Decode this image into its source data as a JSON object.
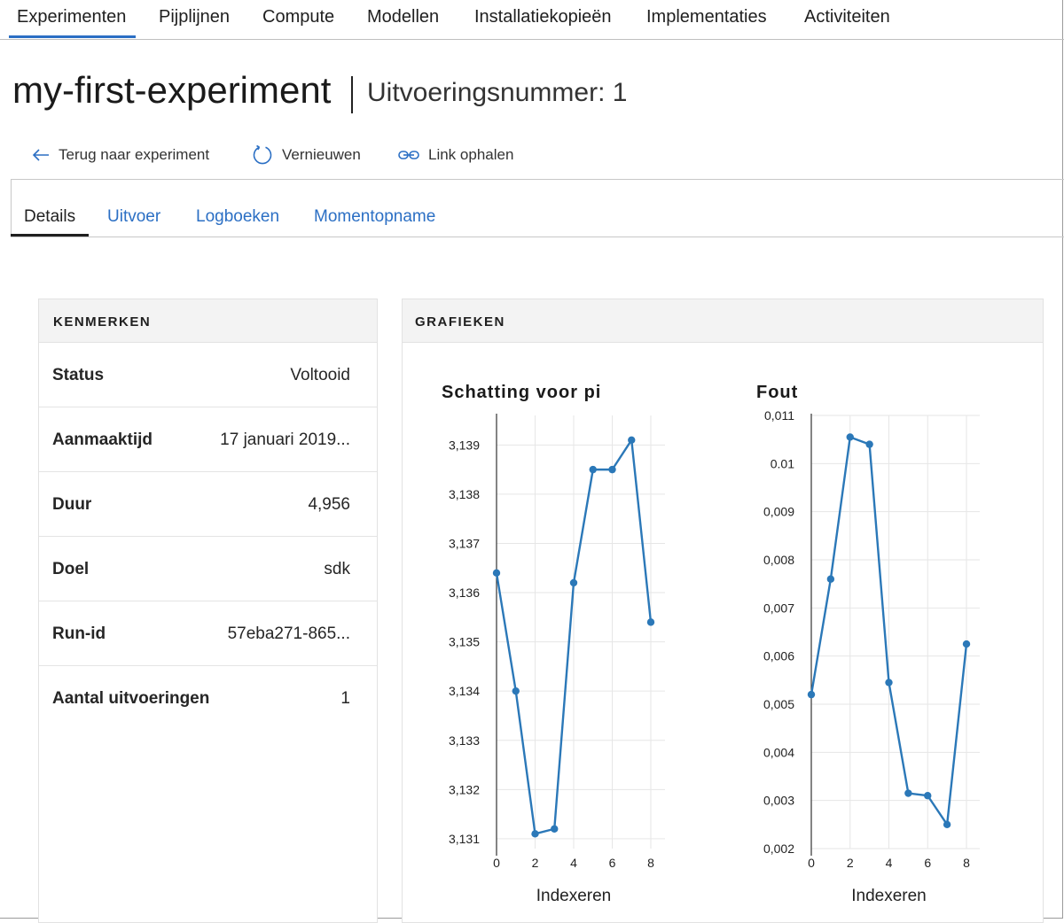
{
  "topnav": {
    "items": [
      "Experimenten",
      "Pijplijnen",
      "Compute",
      "Modellen",
      "Installatiekopieën",
      "Implementaties",
      "Activiteiten"
    ],
    "active": "Experimenten"
  },
  "header": {
    "title": "my-first-experiment",
    "subtitle": "Uitvoeringsnummer: 1"
  },
  "actions": {
    "back": "Terug naar experiment",
    "refresh": "Vernieuwen",
    "link": "Link ophalen"
  },
  "subtabs": {
    "items": [
      "Details",
      "Uitvoer",
      "Logboeken",
      "Momentopname"
    ],
    "active": "Details"
  },
  "properties": {
    "heading": "KENMERKEN",
    "rows": [
      {
        "key": "Status",
        "value": "Voltooid"
      },
      {
        "key": "Aanmaaktijd",
        "value": "17 januari 2019..."
      },
      {
        "key": "Duur",
        "value": "4,956"
      },
      {
        "key": "Doel",
        "value": "sdk"
      },
      {
        "key": "Run-id",
        "value": "57eba271-865..."
      },
      {
        "key": "Aantal uitvoeringen",
        "value": "1"
      }
    ]
  },
  "charts": {
    "heading": "GRAFIEKEN",
    "color": "#2b78b8"
  },
  "chart_data": [
    {
      "type": "line",
      "title": "Schatting voor pi",
      "xlabel": "Indexeren",
      "ylabel": "",
      "x": [
        0,
        1,
        2,
        3,
        4,
        5,
        6,
        7,
        8
      ],
      "y": [
        3.1364,
        3.134,
        3.1311,
        3.1312,
        3.1362,
        3.1385,
        3.1385,
        3.1391,
        3.1354
      ],
      "xlim": [
        0,
        8
      ],
      "ylim": [
        3.1308,
        3.1396
      ],
      "xticks": [
        0,
        2,
        4,
        6,
        8
      ],
      "xtick_labels": [
        "0",
        "2",
        "4",
        "6",
        "8"
      ],
      "yticks": [
        3.131,
        3.132,
        3.133,
        3.134,
        3.135,
        3.136,
        3.137,
        3.138,
        3.139
      ],
      "ytick_labels": [
        "3,131",
        "3,132",
        "3,133",
        "3,134",
        "3,135",
        "3,136",
        "3,137",
        "3,138",
        "3,139"
      ],
      "grid": true
    },
    {
      "type": "line",
      "title": "Fout",
      "xlabel": "Indexeren",
      "ylabel": "",
      "x": [
        0,
        1,
        2,
        3,
        4,
        5,
        6,
        7,
        8
      ],
      "y": [
        0.0052,
        0.0076,
        0.01055,
        0.0104,
        0.00545,
        0.00315,
        0.0031,
        0.0025,
        0.00625
      ],
      "xlim": [
        0,
        8
      ],
      "ylim": [
        0.002,
        0.011
      ],
      "xticks": [
        0,
        2,
        4,
        6,
        8
      ],
      "xtick_labels": [
        "0",
        "2",
        "4",
        "6",
        "8"
      ],
      "yticks": [
        0.002,
        0.003,
        0.004,
        0.005,
        0.006,
        0.007,
        0.008,
        0.009,
        0.01,
        0.011
      ],
      "ytick_labels": [
        "0,002",
        "0,003",
        "0,004",
        "0,005",
        "0,006",
        "0,007",
        "0,008",
        "0,009",
        "0.01",
        "0,011"
      ],
      "grid": true
    }
  ]
}
